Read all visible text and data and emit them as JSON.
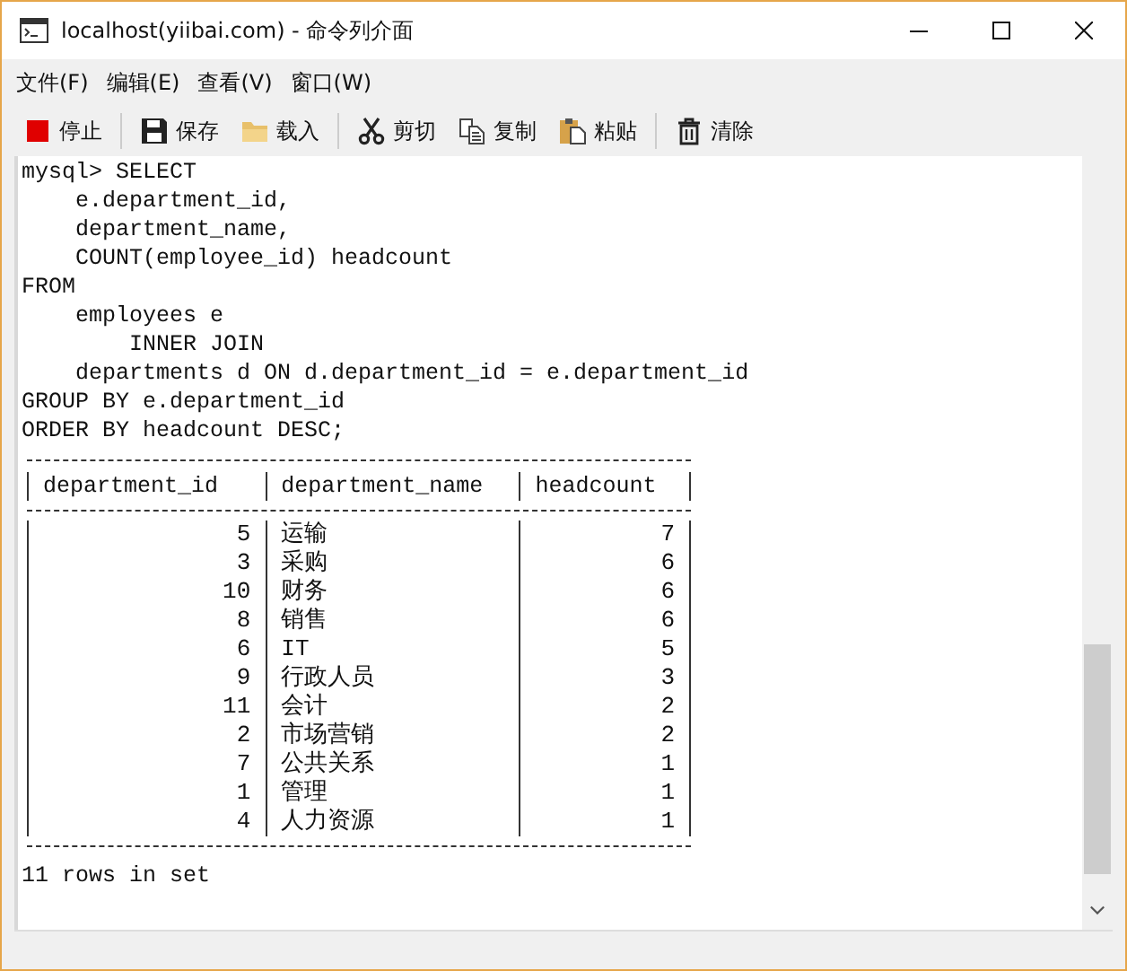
{
  "window": {
    "title": "localhost(yiibai.com) - 命令列介面"
  },
  "menu": [
    "文件(F)",
    "编辑(E)",
    "查看(V)",
    "窗口(W)"
  ],
  "toolbar": [
    {
      "kind": "stop",
      "label": "停止"
    },
    {
      "kind": "save",
      "label": "保存"
    },
    {
      "kind": "load",
      "label": "载入"
    },
    {
      "kind": "cut",
      "label": "剪切"
    },
    {
      "kind": "copy",
      "label": "复制"
    },
    {
      "kind": "paste",
      "label": "粘贴"
    },
    {
      "kind": "clear",
      "label": "清除"
    }
  ],
  "console": {
    "lines": [
      "mysql> SELECT",
      "    e.department_id,",
      "    department_name,",
      "    COUNT(employee_id) headcount",
      "FROM",
      "    employees e",
      "        INNER JOIN",
      "    departments d ON d.department_id = e.department_id",
      "GROUP BY e.department_id",
      "ORDER BY headcount DESC;"
    ],
    "result": {
      "columns": [
        "department_id",
        "department_name",
        "headcount"
      ],
      "rows": [
        [
          "5",
          "运输",
          "7"
        ],
        [
          "3",
          "采购",
          "6"
        ],
        [
          "10",
          "财务",
          "6"
        ],
        [
          "8",
          "销售",
          "6"
        ],
        [
          "6",
          "IT",
          "5"
        ],
        [
          "9",
          "行政人员",
          "3"
        ],
        [
          "11",
          "会计",
          "2"
        ],
        [
          "2",
          "市场营销",
          "2"
        ],
        [
          "7",
          "公共关系",
          "1"
        ],
        [
          "1",
          "管理",
          "1"
        ],
        [
          "4",
          "人力资源",
          "1"
        ]
      ]
    },
    "footer": "11 rows in set"
  }
}
